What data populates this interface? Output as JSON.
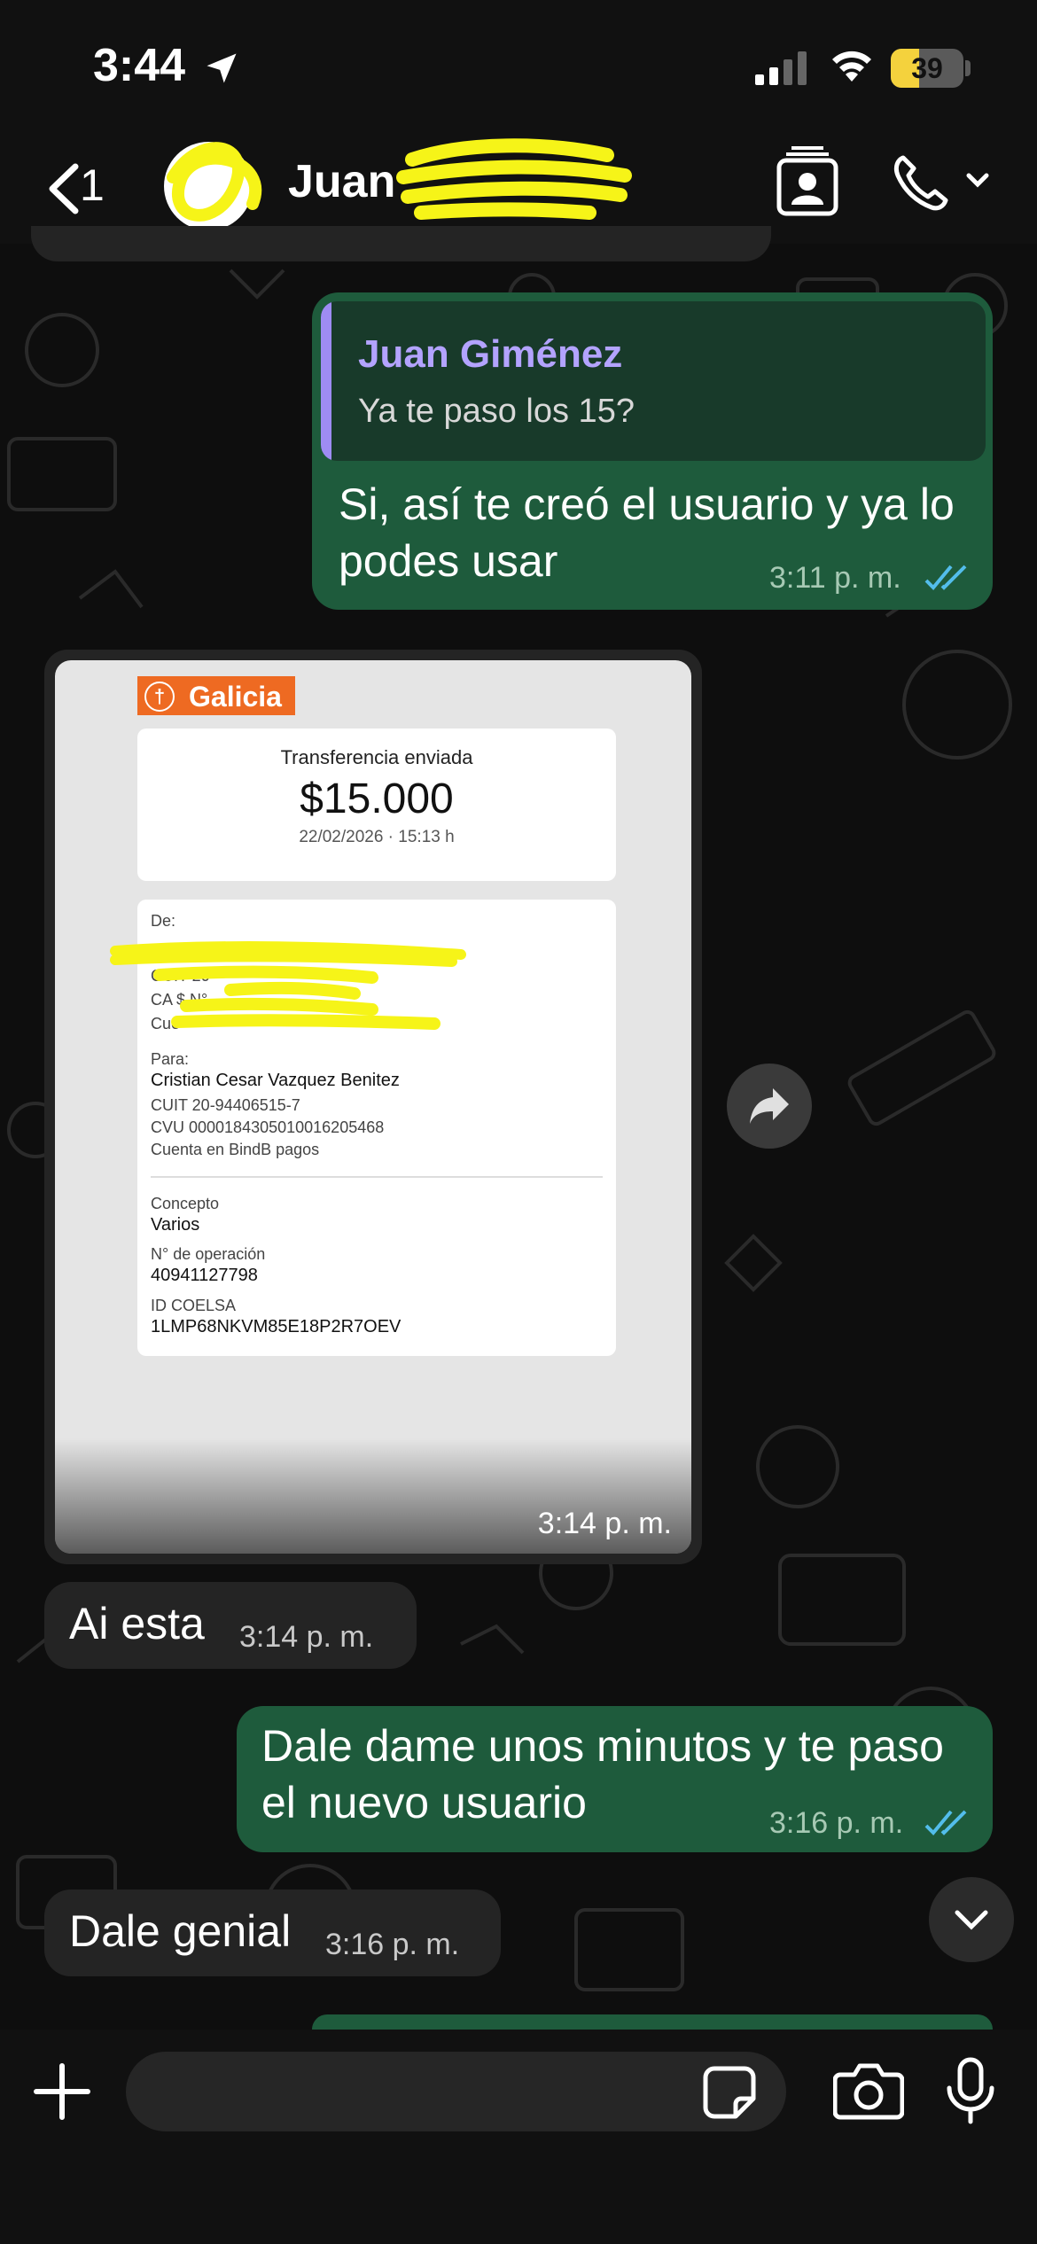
{
  "status_bar": {
    "time": "3:44",
    "battery": "39",
    "battery_fraction": 0.39
  },
  "header": {
    "back_count": "1",
    "contact_name": "Juan"
  },
  "messages": [
    {
      "quoted_author": "Juan Giménez",
      "quoted_text": "Ya te paso los 15?",
      "line1": "Si, así te creó el usuario y ya lo",
      "line2": "podes usar",
      "time": "3:11 p. m."
    },
    {
      "image_time": "3:14 p. m."
    },
    {
      "text": "Ai esta",
      "time": "3:14 p. m."
    },
    {
      "line1": "Dale dame unos minutos y te paso",
      "line2": "el nuevo usuario",
      "time": "3:16 p. m."
    },
    {
      "text": "Dale genial",
      "time": "3:16 p. m."
    }
  ],
  "receipt": {
    "bank": "Galicia",
    "title": "Transferencia enviada",
    "amount": "$15.000",
    "datetime": "22/02/2026 · 15:13 h",
    "from_label": "De:",
    "from_cuit_prefix": "CUIT 20",
    "from_ca_prefix": "CA $ N°",
    "from_cuenta_prefix": "Cue",
    "to_label": "Para:",
    "to_name": "Cristian Cesar Vazquez Benitez",
    "to_cuit": "CUIT 20-94406515-7",
    "to_cvu": "CVU 0000184305010016205468",
    "to_account": "Cuenta en BindB pagos",
    "concept_label": "Concepto",
    "concept_value": "Varios",
    "operation_label": "N° de operación",
    "operation_value": "40941127798",
    "coelsa_label": "ID COELSA",
    "coelsa_value": "1LMP68NKVM85E18P2R7OEV"
  },
  "input": {
    "placeholder": ""
  },
  "colors": {
    "outgoing_bubble": "#1e5b3c",
    "incoming_bubble": "#242424",
    "read_ticks": "#53bdeb",
    "galicia_orange": "#ee6a22"
  }
}
